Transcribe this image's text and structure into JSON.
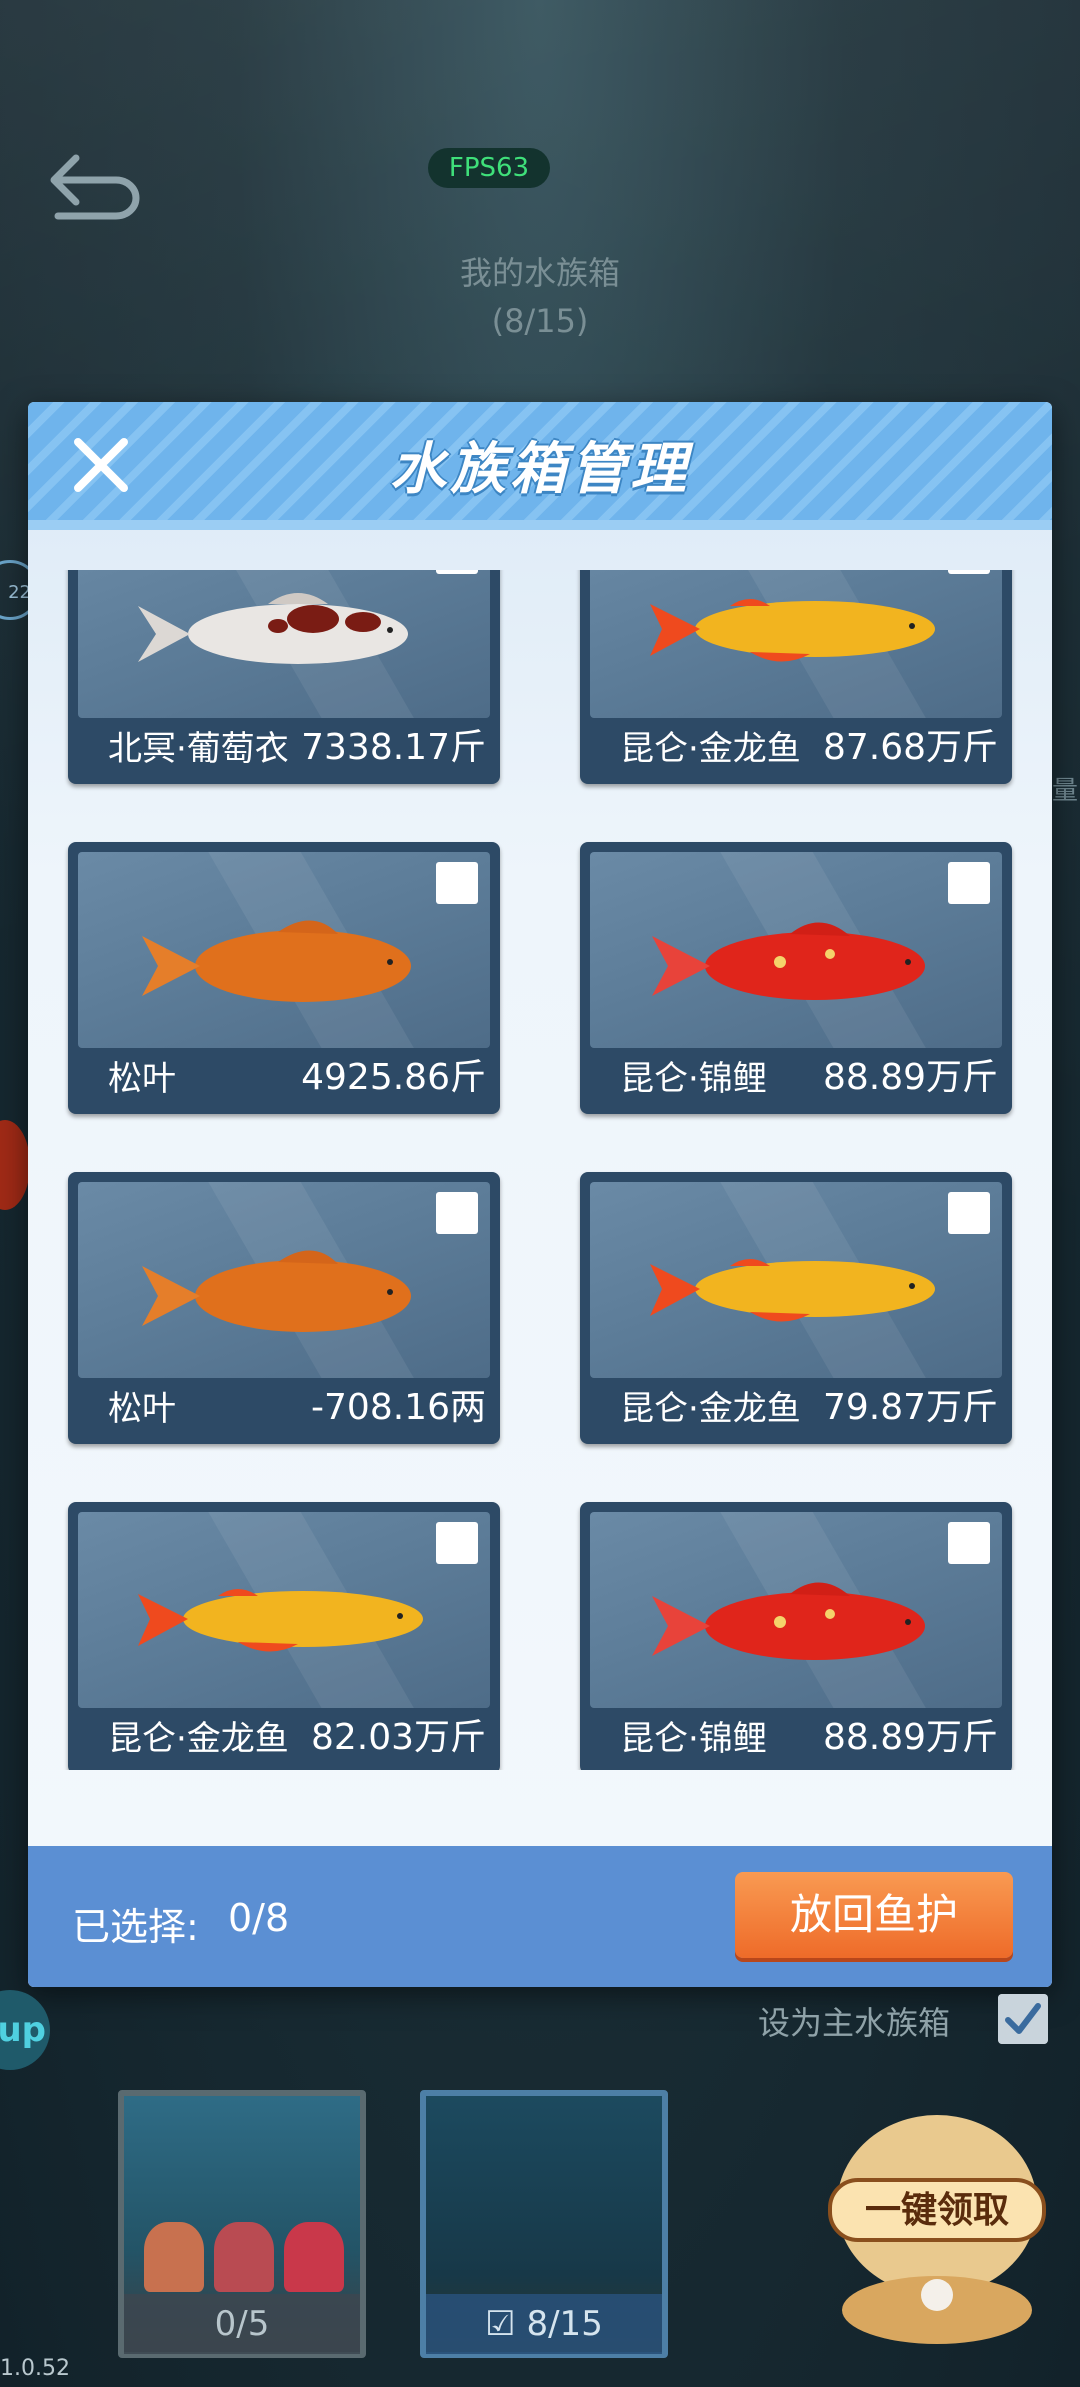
{
  "top": {
    "fps": "FPS63",
    "tank_title": "我的水族箱",
    "tank_count": "(8/15)"
  },
  "modal": {
    "title": "水族箱管理",
    "fish_cards": [
      {
        "name": "北冥·葡萄衣",
        "weight": "7338.17斤",
        "fish": "white-red-koi"
      },
      {
        "name": "昆仑·金龙鱼",
        "weight": "87.68万斤",
        "fish": "golden-arowana"
      },
      {
        "name": "松叶",
        "weight": "4925.86斤",
        "fish": "orange-carp"
      },
      {
        "name": "昆仑·锦鲤",
        "weight": "88.89万斤",
        "fish": "red-koi"
      },
      {
        "name": "松叶",
        "weight": "-708.16两",
        "fish": "orange-carp"
      },
      {
        "name": "昆仑·金龙鱼",
        "weight": "79.87万斤",
        "fish": "golden-arowana"
      },
      {
        "name": "昆仑·金龙鱼",
        "weight": "82.03万斤",
        "fish": "golden-arowana"
      },
      {
        "name": "昆仑·锦鲤",
        "weight": "88.89万斤",
        "fish": "red-koi"
      }
    ],
    "selected_label": "已选择:",
    "selected_count": "0/8",
    "release_button": "放回鱼护"
  },
  "bottom": {
    "set_main_label": "设为主水族箱",
    "thumb1_caption": "0/5",
    "thumb2_caption": "8/15",
    "claim_text": "一键领取",
    "left_badge": "22",
    "up_badge": "up",
    "right_edge": "量",
    "version": "1.0.52"
  },
  "colors": {
    "header_blue": "#6fb4ec",
    "footer_blue": "#5b8fd3",
    "button_orange": "#ee6b29",
    "fps_green": "#3fe07a"
  }
}
